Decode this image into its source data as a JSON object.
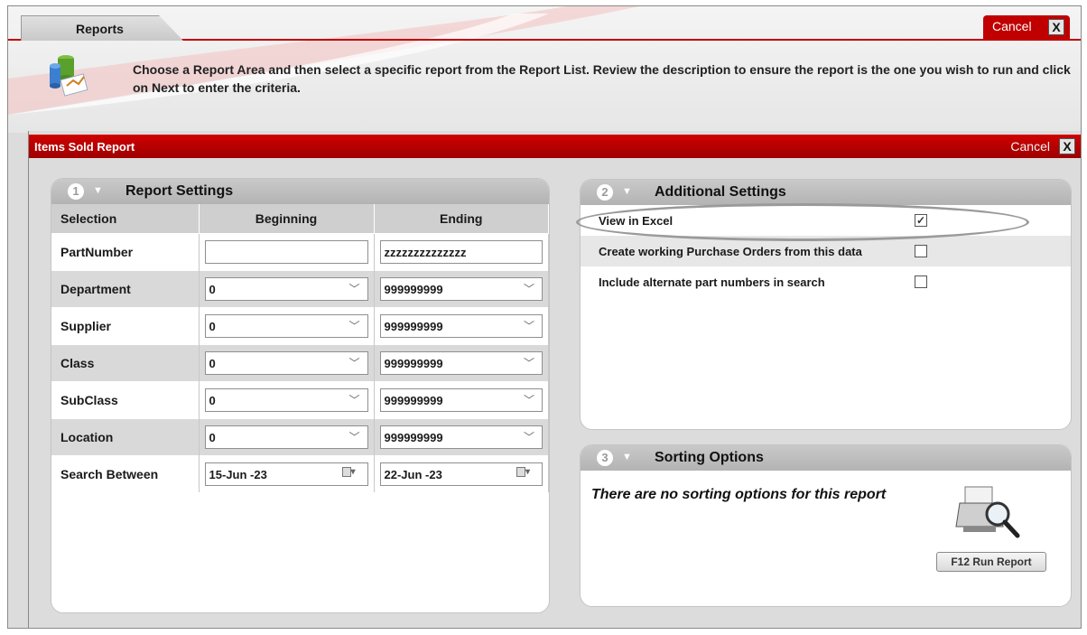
{
  "window": {
    "tab_label": "Reports",
    "cancel_label": "Cancel",
    "close_glyph": "X",
    "intro_text": "Choose a Report Area and then select a specific report from the Report List. Review the description to ensure the report is the one you wish to run and click on Next to enter the criteria.",
    "accent_color": "#c00000"
  },
  "dialog": {
    "title": "Items Sold Report",
    "cancel_label": "Cancel",
    "close_glyph": "X"
  },
  "report_settings": {
    "number": "1",
    "title": "Report Settings",
    "columns": [
      "Selection",
      "Beginning",
      "Ending"
    ],
    "rows": [
      {
        "label": "PartNumber",
        "beginning": "",
        "ending": "zzzzzzzzzzzzzz",
        "type": "text"
      },
      {
        "label": "Department",
        "beginning": "0",
        "ending": "999999999",
        "type": "select"
      },
      {
        "label": "Supplier",
        "beginning": "0",
        "ending": "999999999",
        "type": "select"
      },
      {
        "label": "Class",
        "beginning": "0",
        "ending": "999999999",
        "type": "select"
      },
      {
        "label": "SubClass",
        "beginning": "0",
        "ending": "999999999",
        "type": "select"
      },
      {
        "label": "Location",
        "beginning": "0",
        "ending": "999999999",
        "type": "select"
      },
      {
        "label": "Search Between",
        "beginning": "15-Jun -23",
        "ending": "22-Jun -23",
        "type": "date"
      }
    ]
  },
  "additional_settings": {
    "number": "2",
    "title": "Additional Settings",
    "options": [
      {
        "label": "View in Excel",
        "checked": true
      },
      {
        "label": "Create working Purchase Orders from this data",
        "checked": false
      },
      {
        "label": "Include alternate part numbers in search",
        "checked": false
      }
    ]
  },
  "sorting_options": {
    "number": "3",
    "title": "Sorting Options",
    "note": "There are no sorting options for this report",
    "run_button": "F12  Run Report"
  },
  "icons": [
    "reports-icon",
    "printer-icon",
    "calendar-icon",
    "chevron-down-icon",
    "close-icon"
  ]
}
